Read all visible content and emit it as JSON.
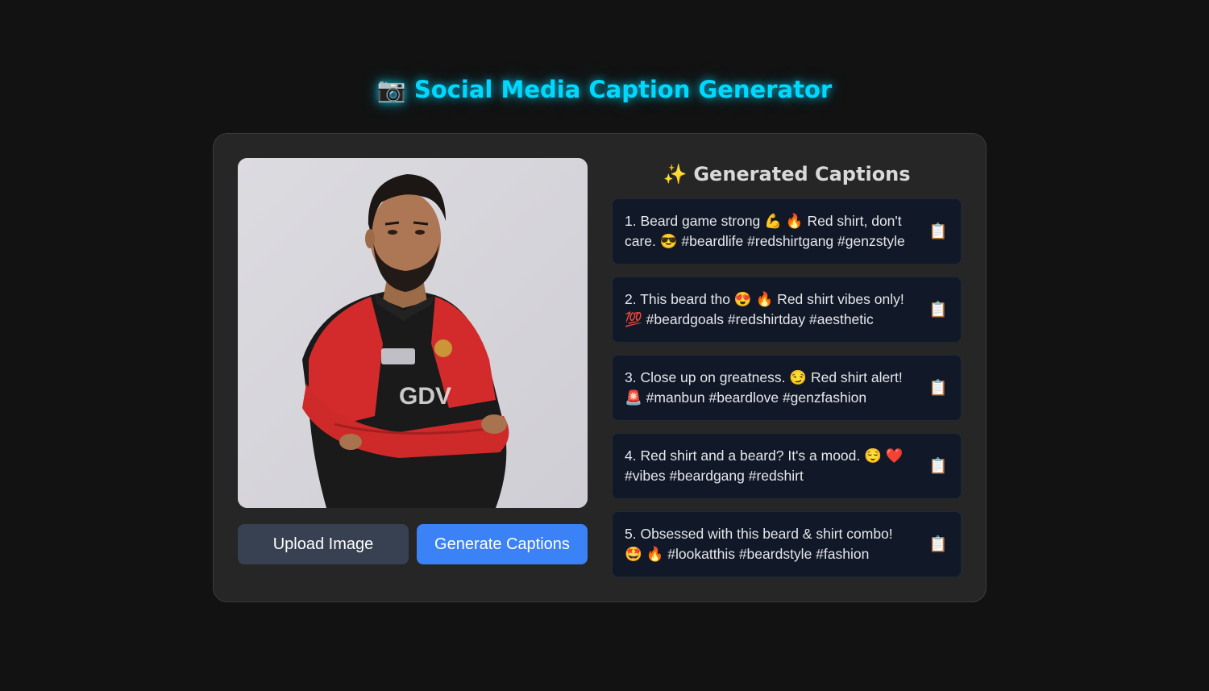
{
  "header": {
    "icon": "camera-icon",
    "camera_glyph": "📷",
    "title": "Social Media Caption Generator"
  },
  "image_panel": {
    "alt": "Uploaded image preview",
    "upload_label": "Upload Image",
    "generate_label": "Generate Captions"
  },
  "captions_panel": {
    "sparkle_glyph": "✨",
    "heading": "Generated Captions",
    "copy_glyph": "📋",
    "items": [
      "1. Beard game strong 💪 🔥 Red shirt, don't care. 😎 #beardlife #redshirtgang #genzstyle",
      "2. This beard tho 😍 🔥 Red shirt vibes only! 💯 #beardgoals #redshirtday #aesthetic",
      "3. Close up on greatness. 😏 Red shirt alert! 🚨 #manbun #beardlove #genzfashion",
      "4. Red shirt and a beard? It's a mood. 😌 ❤️ #vibes #beardgang #redshirt",
      "5. Obsessed with this beard & shirt combo! 🤩 🔥 #lookatthis #beardstyle #fashion"
    ]
  },
  "colors": {
    "background": "#121212",
    "card": "#262626",
    "title_accent": "#00d9ff",
    "upload_button": "#374151",
    "generate_button": "#3b82f6",
    "caption_bg": "#111827"
  }
}
